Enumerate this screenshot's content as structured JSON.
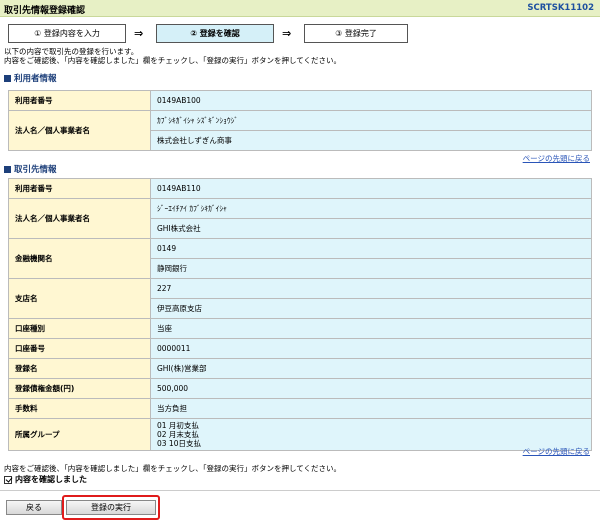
{
  "header": {
    "title": "取引先情報登録確認",
    "screen_id": "SCRTSK11102"
  },
  "steps": [
    {
      "label": "① 登録内容を入力"
    },
    {
      "label": "② 登録を確認"
    },
    {
      "label": "③ 登録完了"
    }
  ],
  "step_arrow": "⇒",
  "intro": {
    "line1": "以下の内容で取引先の登録を行います。",
    "line2": "内容をご確認後、「内容を確認しました」欄をチェックし、「登録の実行」ボタンを押してください。"
  },
  "user_info": {
    "section_title": "利用者情報",
    "user_no_label": "利用者番号",
    "user_no": "0149AB100",
    "name_label": "法人名／個人事業者名",
    "name_kana": "ｶﾌﾞｼｷｶﾞｲｼｬ ｼｽﾞｷﾞﾝｼｮｳｼﾞ",
    "name_kanji": "株式会社しずぎん商事"
  },
  "partner_info": {
    "section_title": "取引先情報",
    "user_no_label": "利用者番号",
    "user_no": "0149AB110",
    "name_label": "法人名／個人事業者名",
    "name_kana": "ｼﾞｰｴｲﾁｱｲ ｶﾌﾞｼｷｶﾞｲｼｬ",
    "name_kanji": "GHI株式会社",
    "bank_label": "金融機関名",
    "bank_code": "0149",
    "bank_name": "静岡銀行",
    "branch_label": "支店名",
    "branch_code": "227",
    "branch_name": "伊豆高原支店",
    "account_type_label": "口座種別",
    "account_type": "当座",
    "account_no_label": "口座番号",
    "account_no": "0000011",
    "reg_name_label": "登録名",
    "reg_name": "GHI(株)営業部",
    "amount_label": "登録債権金額(円)",
    "amount": "500,000",
    "fee_label": "手数料",
    "fee": "当方負担",
    "group_label": "所属グループ",
    "groups": [
      "01 月初支払",
      "02 月末支払",
      "03 10日支払"
    ]
  },
  "page_top_link": "ページの先頭に戻る",
  "bottom": {
    "note": "内容をご確認後、「内容を確認しました」欄をチェックし、「登録の実行」ボタンを押してください。",
    "checkbox_label": "内容を確認しました",
    "checkbox_checked": true
  },
  "buttons": {
    "back": "戻る",
    "execute": "登録の実行"
  },
  "colors": {
    "highlight": "#e01b1b",
    "title_bg": "#e7f0c5",
    "label_bg": "#fff7d2",
    "value_bg": "#dff5fb"
  }
}
